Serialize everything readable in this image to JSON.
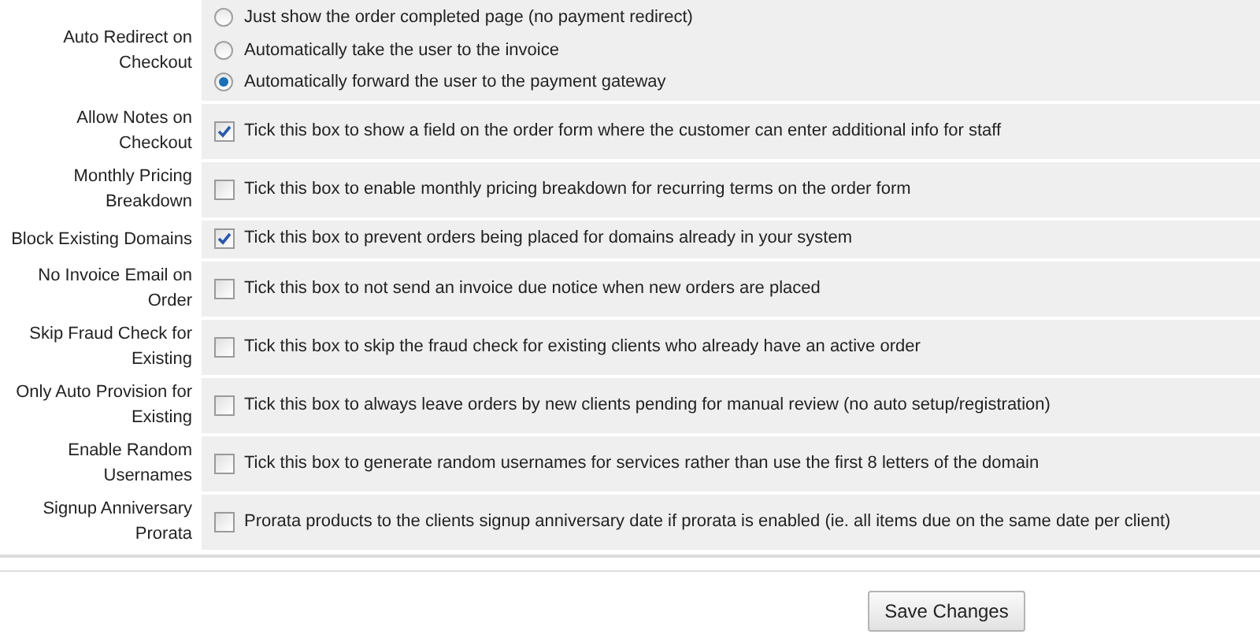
{
  "settings": [
    {
      "kind": "radio",
      "label": "Auto Redirect on Checkout",
      "options": [
        {
          "text": "Just show the order completed page (no payment redirect)",
          "selected": false
        },
        {
          "text": "Automatically take the user to the invoice",
          "selected": false
        },
        {
          "text": "Automatically forward the user to the payment gateway",
          "selected": true
        }
      ]
    },
    {
      "kind": "checkbox",
      "label": "Allow Notes on Checkout",
      "checked": true,
      "text": "Tick this box to show a field on the order form where the customer can enter additional info for staff"
    },
    {
      "kind": "checkbox",
      "label": "Monthly Pricing Breakdown",
      "checked": false,
      "text": "Tick this box to enable monthly pricing breakdown for recurring terms on the order form"
    },
    {
      "kind": "checkbox",
      "label": "Block Existing Domains",
      "checked": true,
      "text": "Tick this box to prevent orders being placed for domains already in your system"
    },
    {
      "kind": "checkbox",
      "label": "No Invoice Email on Order",
      "checked": false,
      "text": "Tick this box to not send an invoice due notice when new orders are placed"
    },
    {
      "kind": "checkbox",
      "label": "Skip Fraud Check for Existing",
      "checked": false,
      "text": "Tick this box to skip the fraud check for existing clients who already have an active order"
    },
    {
      "kind": "checkbox",
      "label": "Only Auto Provision for Existing",
      "checked": false,
      "text": "Tick this box to always leave orders by new clients pending for manual review (no auto setup/registration)"
    },
    {
      "kind": "checkbox",
      "label": "Enable Random Usernames",
      "checked": false,
      "text": "Tick this box to generate random usernames for services rather than use the first 8 letters of the domain"
    },
    {
      "kind": "checkbox",
      "label": "Signup Anniversary Prorata",
      "checked": false,
      "text": "Prorata products to the clients signup anniversary date if prorata is enabled (ie. all items due on the same date per client)"
    }
  ],
  "save_button": "Save Changes"
}
